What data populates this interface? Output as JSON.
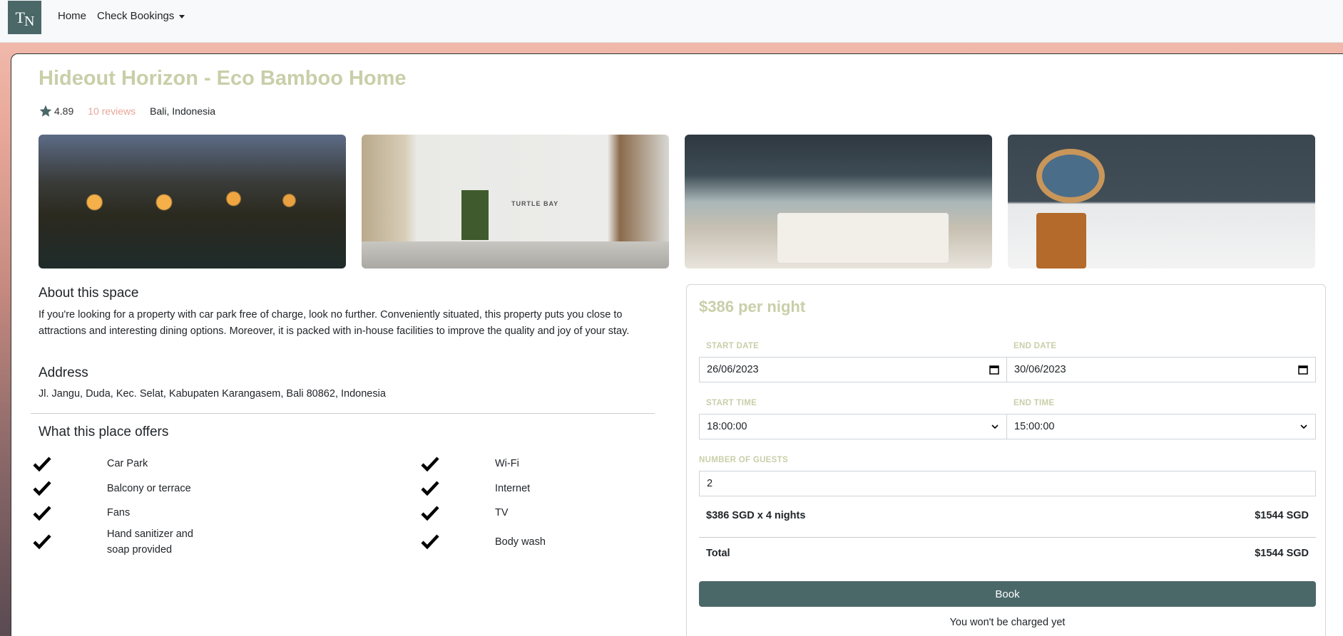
{
  "navbar": {
    "logo_t": "T",
    "logo_n": "N",
    "home_label": "Home",
    "bookings_label": "Check Bookings"
  },
  "listing": {
    "title": "Hideout Horizon - Eco Bamboo Home",
    "rating": "4.89",
    "reviews": "10 reviews",
    "location": "Bali, Indonesia",
    "photo_sign_text": "TURTLE BAY"
  },
  "about": {
    "heading": "About this space",
    "text": "If you're looking for a property with car park free of charge, look no further. Conveniently situated, this property puts you close to attractions and interesting dining options. Moreover, it is packed with in-house facilities to improve the quality and joy of your stay."
  },
  "address": {
    "heading": "Address",
    "text": "Jl. Jangu, Duda, Kec. Selat, Kabupaten Karangasem, Bali 80862, Indonesia"
  },
  "offers": {
    "heading": "What this place offers",
    "items": [
      "Car Park",
      "Wi-Fi",
      "Balcony or terrace",
      "Internet",
      "Fans",
      "TV",
      "Hand sanitizer and soap provided",
      "Body wash"
    ]
  },
  "booking": {
    "price": "$386 per night",
    "start_date_label": "START DATE",
    "end_date_label": "END DATE",
    "start_date": "26/06/2023",
    "end_date": "30/06/2023",
    "start_time_label": "START TIME",
    "end_time_label": "END TIME",
    "start_time": "18:00:00",
    "end_time": "15:00:00",
    "guests_label": "NUMBER OF GUESTS",
    "guests": "2",
    "subtotal_label": "$386 SGD x 4 nights",
    "subtotal_value": "$1544 SGD",
    "total_label": "Total",
    "total_value": "$1544 SGD",
    "book_label": "Book",
    "note": "You won't be charged yet"
  },
  "colors": {
    "accent": "#4b6869",
    "title": "#c8cfa9",
    "reviews": "#e6a699"
  }
}
